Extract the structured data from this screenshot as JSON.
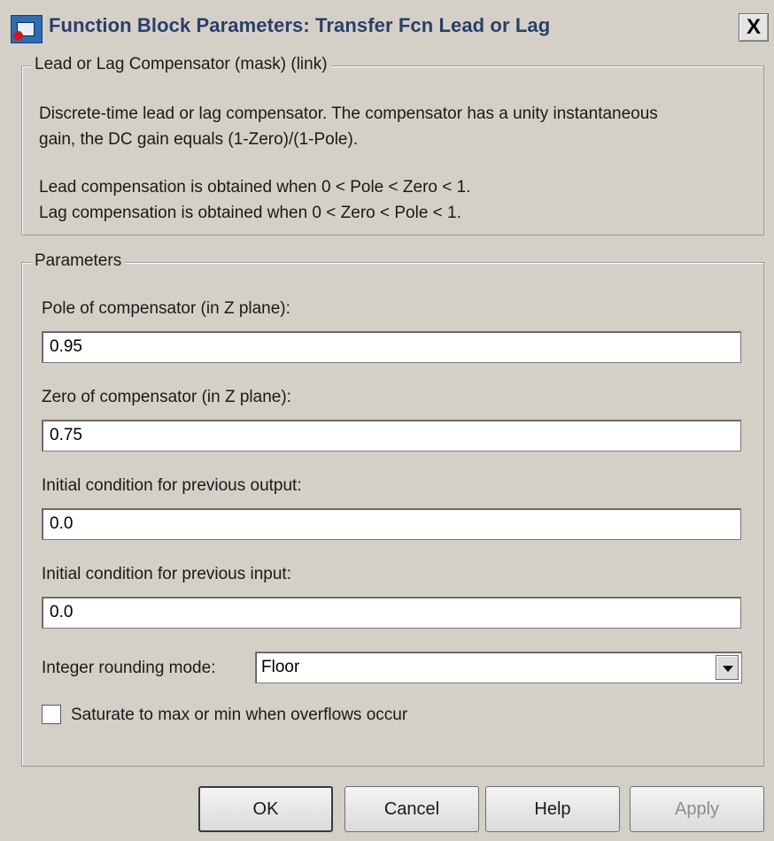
{
  "window": {
    "title": "Function Block Parameters: Transfer Fcn Lead or Lag",
    "close_glyph": "X"
  },
  "mask_group": {
    "legend": "Lead or Lag Compensator (mask) (link)",
    "description": [
      "Discrete-time lead or lag compensator.  The compensator has a unity instantaneous",
      "gain, the DC gain equals (1-Zero)/(1-Pole).",
      "Lead compensation is obtained when 0 < Pole < Zero < 1.",
      "Lag compensation is obtained when 0 < Zero < Pole < 1."
    ]
  },
  "params_group": {
    "legend": "Parameters",
    "pole": {
      "label": "Pole of compensator (in Z plane):",
      "value": "0.95"
    },
    "zero": {
      "label": "Zero of compensator (in Z plane):",
      "value": "0.75"
    },
    "ic_output": {
      "label": "Initial condition for previous output:",
      "value": "0.0"
    },
    "ic_input": {
      "label": "Initial condition for previous input:",
      "value": "0.0"
    },
    "rounding": {
      "label": "Integer rounding mode:",
      "value": "Floor"
    },
    "saturate": {
      "label": "Saturate to max or min when overflows occur",
      "checked": false
    }
  },
  "buttons": {
    "ok": "OK",
    "cancel": "Cancel",
    "help": "Help",
    "apply": "Apply"
  },
  "icons": {
    "app": "simulink-app-icon",
    "close": "close-icon",
    "dropdown": "chevron-down-icon"
  }
}
